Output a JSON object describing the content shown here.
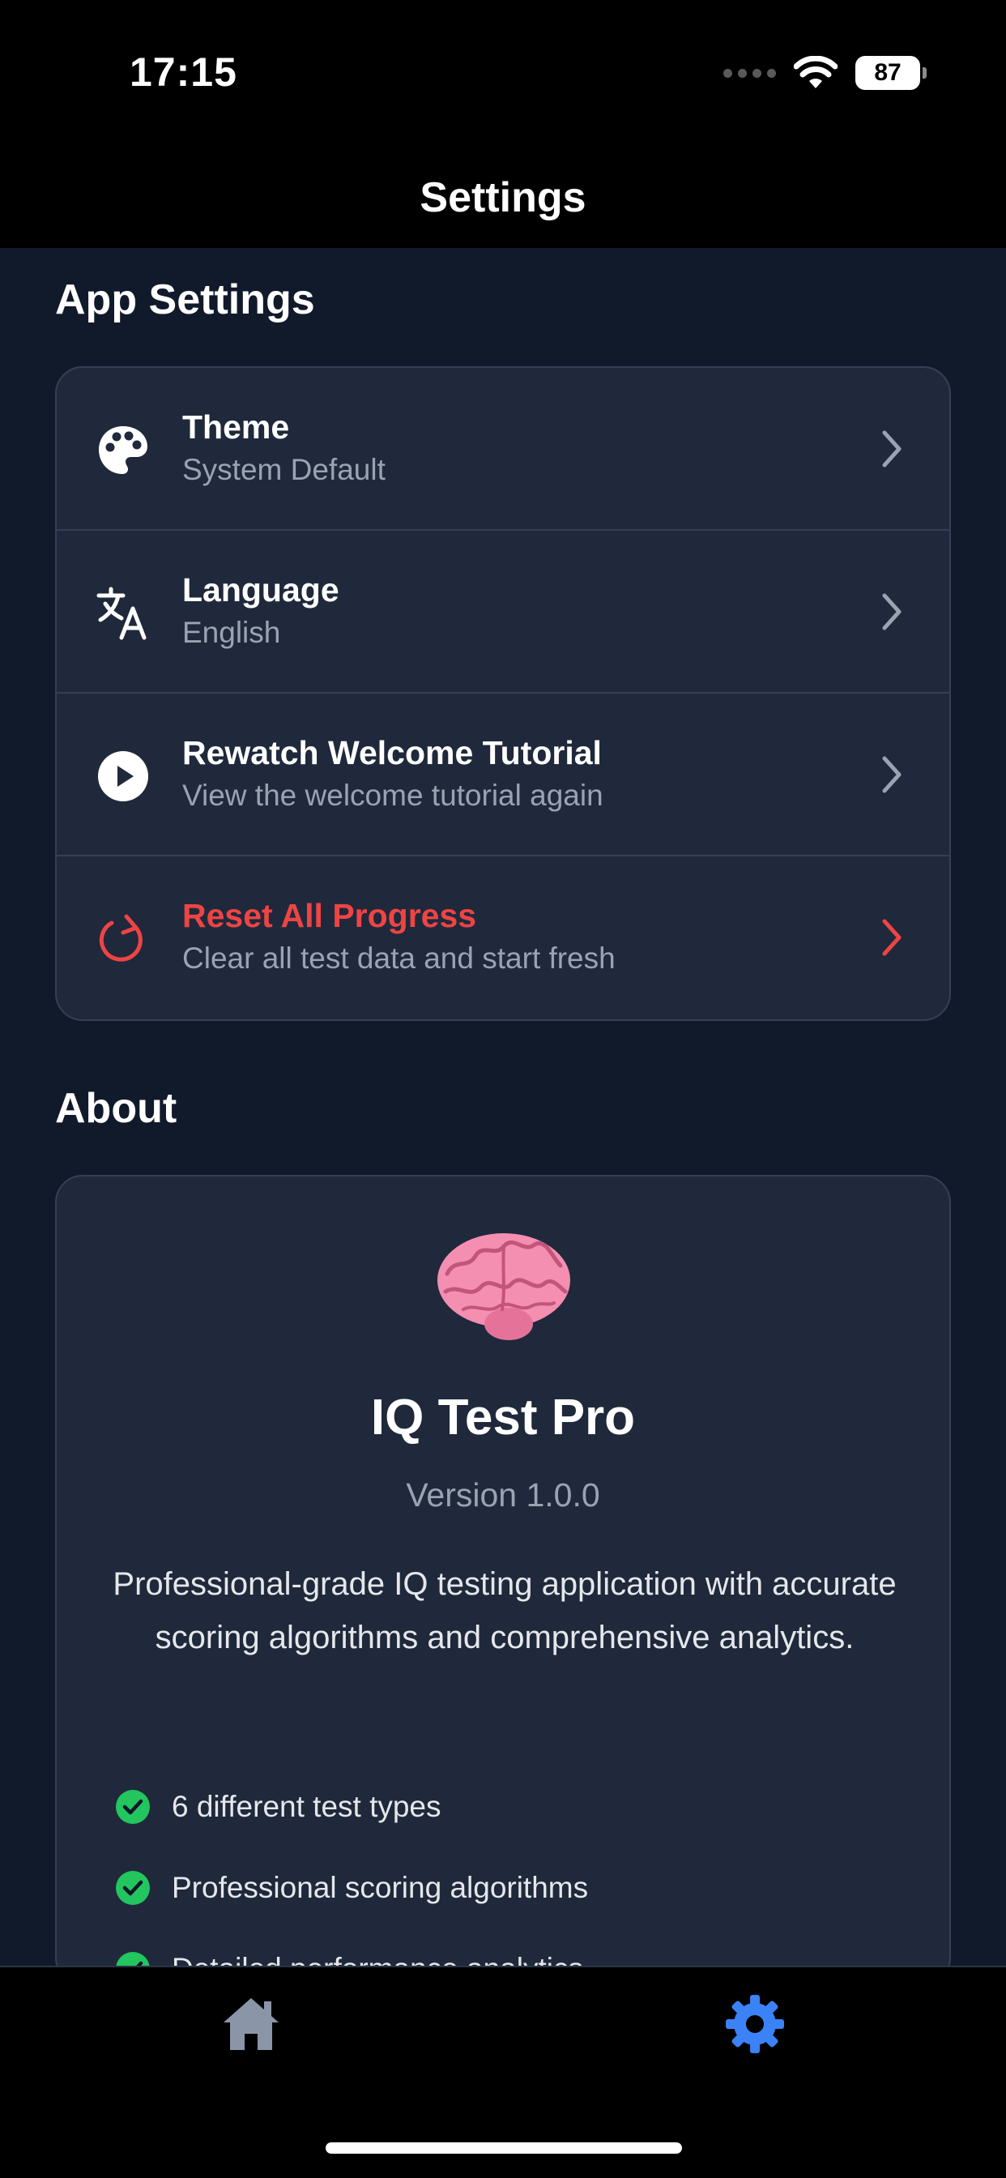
{
  "status_bar": {
    "time": "17:15",
    "battery": "87"
  },
  "header": {
    "title": "Settings"
  },
  "app_settings": {
    "section_title": "App Settings",
    "items": [
      {
        "title": "Theme",
        "subtitle": "System Default",
        "icon": "palette-icon"
      },
      {
        "title": "Language",
        "subtitle": "English",
        "icon": "translate-icon"
      },
      {
        "title": "Rewatch Welcome Tutorial",
        "subtitle": "View the welcome tutorial again",
        "icon": "play-icon"
      },
      {
        "title": "Reset All Progress",
        "subtitle": "Clear all test data and start fresh",
        "icon": "reset-icon"
      }
    ]
  },
  "about": {
    "section_title": "About",
    "app_name": "IQ Test Pro",
    "version": "Version 1.0.0",
    "description": "Professional-grade IQ testing application with accurate scoring algorithms and comprehensive analytics.",
    "features": [
      "6 different test types",
      "Professional scoring algorithms",
      "Detailed performance analytics"
    ]
  },
  "tab_bar": {
    "active": "settings",
    "icons": [
      "home-icon",
      "settings-gear-icon"
    ]
  },
  "colors": {
    "background": "#111a2b",
    "card": "#1f293b",
    "danger": "#ef4444",
    "accent": "#3b82f6",
    "check": "#22c55e"
  }
}
